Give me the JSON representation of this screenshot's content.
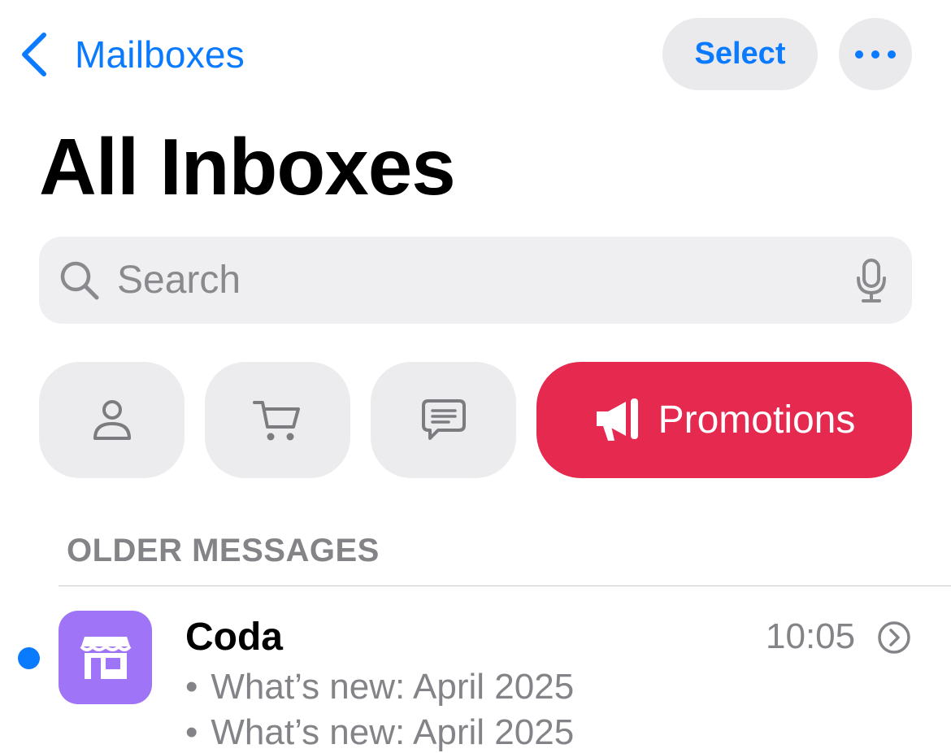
{
  "nav": {
    "back_label": "Mailboxes",
    "select_label": "Select",
    "more_icon": "ellipsis-icon"
  },
  "page_title": "All Inboxes",
  "search": {
    "placeholder": "Search",
    "value": "",
    "icons": [
      "search-icon",
      "microphone-icon"
    ]
  },
  "categories": {
    "items": [
      {
        "icon": "person-icon",
        "label": ""
      },
      {
        "icon": "cart-icon",
        "label": ""
      },
      {
        "icon": "chat-bubble-icon",
        "label": ""
      },
      {
        "icon": "megaphone-icon",
        "label": "Promotions",
        "selected": true
      }
    ],
    "selected_color": "#e5294f"
  },
  "section": {
    "header": "OLDER MESSAGES"
  },
  "messages": [
    {
      "sender": "Coda",
      "time": "10:05",
      "unread": true,
      "avatar_icon": "storefront-icon",
      "avatar_color": "#a074f7",
      "bullet": "•",
      "preview_lines": [
        "What’s new: April 2025",
        "What’s new: April 2025"
      ]
    }
  ],
  "colors": {
    "accent": "#0a7aff",
    "secondary_text": "#838388"
  }
}
